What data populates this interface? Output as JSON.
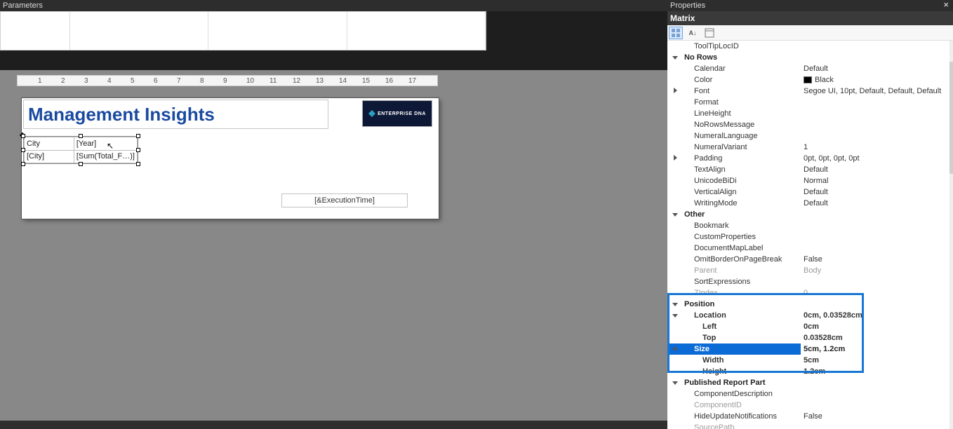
{
  "parameters_panel": {
    "title": "Parameters"
  },
  "properties_panel": {
    "title": "Properties",
    "selected_object": "Matrix",
    "toolbar": {
      "categorized": "Categorized",
      "alphabetical": "Alphabetical",
      "pages": "Property Pages"
    }
  },
  "ruler": {
    "ticks": [
      1,
      2,
      3,
      4,
      5,
      6,
      7,
      8,
      9,
      10,
      11,
      12,
      13,
      14,
      15,
      16,
      17
    ]
  },
  "report": {
    "title": "Management Insights",
    "logo_text": "ENTERPRISE DNA",
    "matrix": {
      "h1": "City",
      "h2": "[Year]",
      "r1": "[City]",
      "r2": "[Sum(Total_F…)]"
    },
    "execution_time": "[&ExecutionTime]"
  },
  "props": {
    "tooltiplocid": {
      "name": "ToolTipLocID",
      "value": ""
    },
    "cat_norows": "No Rows",
    "calendar": {
      "name": "Calendar",
      "value": "Default"
    },
    "color": {
      "name": "Color",
      "value": "Black"
    },
    "font": {
      "name": "Font",
      "value": "Segoe UI, 10pt, Default, Default, Default"
    },
    "format": {
      "name": "Format",
      "value": ""
    },
    "lineheight": {
      "name": "LineHeight",
      "value": ""
    },
    "norowsmessage": {
      "name": "NoRowsMessage",
      "value": ""
    },
    "numerallanguage": {
      "name": "NumeralLanguage",
      "value": ""
    },
    "numeralvariant": {
      "name": "NumeralVariant",
      "value": "1"
    },
    "padding": {
      "name": "Padding",
      "value": "0pt, 0pt, 0pt, 0pt"
    },
    "textalign": {
      "name": "TextAlign",
      "value": "Default"
    },
    "unicodebidi": {
      "name": "UnicodeBiDi",
      "value": "Normal"
    },
    "verticalalign": {
      "name": "VerticalAlign",
      "value": "Default"
    },
    "writingmode": {
      "name": "WritingMode",
      "value": "Default"
    },
    "cat_other": "Other",
    "bookmark": {
      "name": "Bookmark",
      "value": ""
    },
    "customprops": {
      "name": "CustomProperties",
      "value": ""
    },
    "docmaplabel": {
      "name": "DocumentMapLabel",
      "value": ""
    },
    "omitborder": {
      "name": "OmitBorderOnPageBreak",
      "value": "False"
    },
    "parent": {
      "name": "Parent",
      "value": "Body"
    },
    "sortexpr": {
      "name": "SortExpressions",
      "value": ""
    },
    "zindex": {
      "name": "ZIndex",
      "value": "0"
    },
    "cat_position": "Position",
    "location": {
      "name": "Location",
      "value": "0cm, 0.03528cm"
    },
    "left": {
      "name": "Left",
      "value": "0cm"
    },
    "top": {
      "name": "Top",
      "value": "0.03528cm"
    },
    "size": {
      "name": "Size",
      "value": "5cm, 1.2cm"
    },
    "width": {
      "name": "Width",
      "value": "5cm"
    },
    "height": {
      "name": "Height",
      "value": "1.2cm"
    },
    "cat_published": "Published Report Part",
    "compdesc": {
      "name": "ComponentDescription",
      "value": ""
    },
    "compid": {
      "name": "ComponentID",
      "value": ""
    },
    "hideupdate": {
      "name": "HideUpdateNotifications",
      "value": "False"
    },
    "sourcepath": {
      "name": "SourcePath",
      "value": ""
    }
  }
}
